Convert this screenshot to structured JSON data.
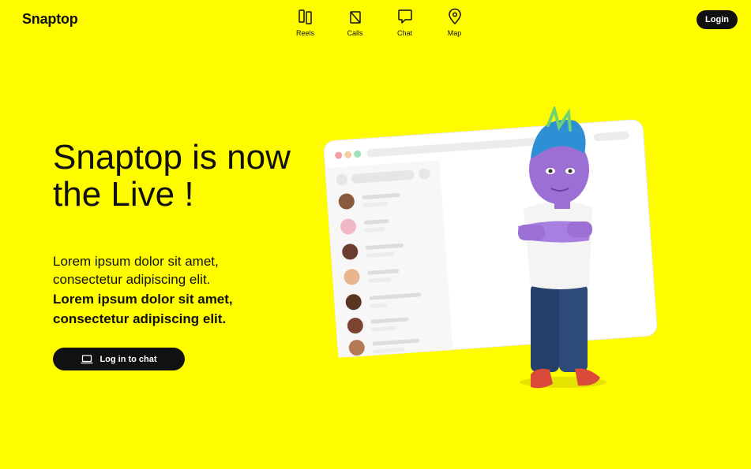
{
  "brand": {
    "name": "Snaptop"
  },
  "nav": {
    "items": [
      {
        "label": "Reels",
        "icon": "reels-icon"
      },
      {
        "label": "Calls",
        "icon": "calls-icon"
      },
      {
        "label": "Chat",
        "icon": "chat-icon"
      },
      {
        "label": "Map",
        "icon": "map-pin-icon"
      }
    ]
  },
  "header": {
    "login_label": "Login"
  },
  "hero": {
    "title": "Snaptop is now the Live !",
    "text_regular": "Lorem ipsum dolor sit amet, consectetur adipiscing elit.",
    "text_bold": "Lorem ipsum dolor sit amet, consectetur adipiscing elit.",
    "cta_label": "Log in to chat",
    "cta_icon": "laptop-icon"
  },
  "colors": {
    "background": "#FFFC00",
    "text": "#111111",
    "button_bg": "#111111",
    "button_text": "#FFFFFF"
  }
}
